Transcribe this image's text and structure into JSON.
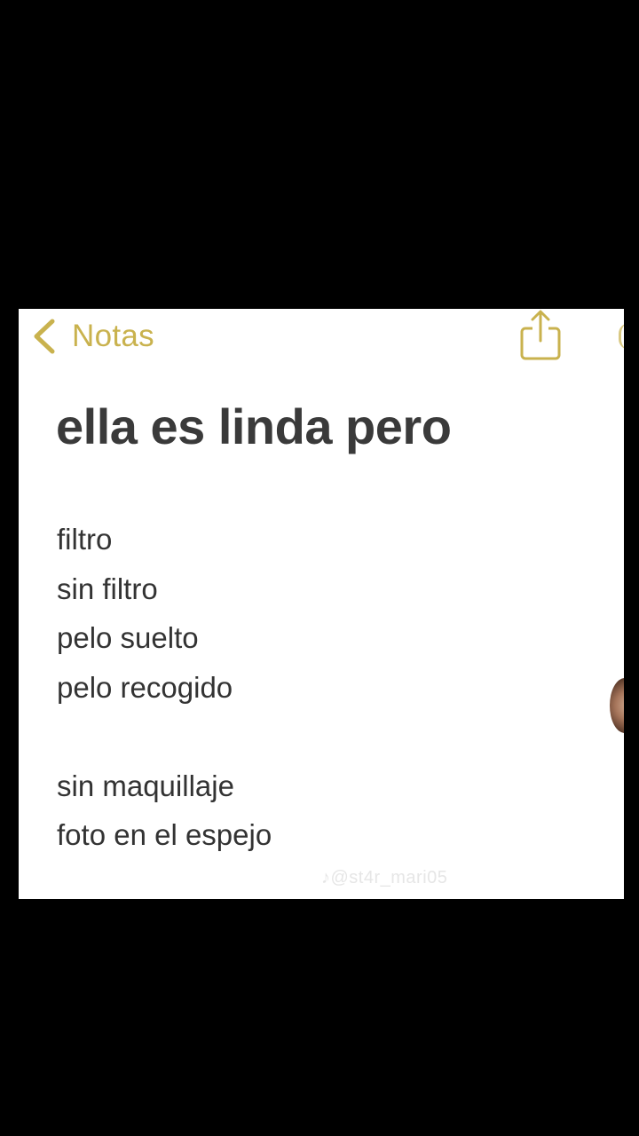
{
  "nav": {
    "back_label": "Notas",
    "back_icon": "chevron-left-icon",
    "share_icon": "share-icon"
  },
  "note": {
    "title": "ella es linda pero",
    "lines_group_1": [
      "filtro",
      "sin filtro",
      "pelo suelto",
      "pelo recogido"
    ],
    "lines_group_2": [
      "sin maquillaje",
      "foto en el espejo"
    ]
  },
  "watermark": {
    "text": "♪@st4r_mari05"
  },
  "colors": {
    "background": "#000000",
    "card": "#ffffff",
    "accent": "#c9b24e",
    "title": "#3a3a3a",
    "body": "#333333"
  }
}
